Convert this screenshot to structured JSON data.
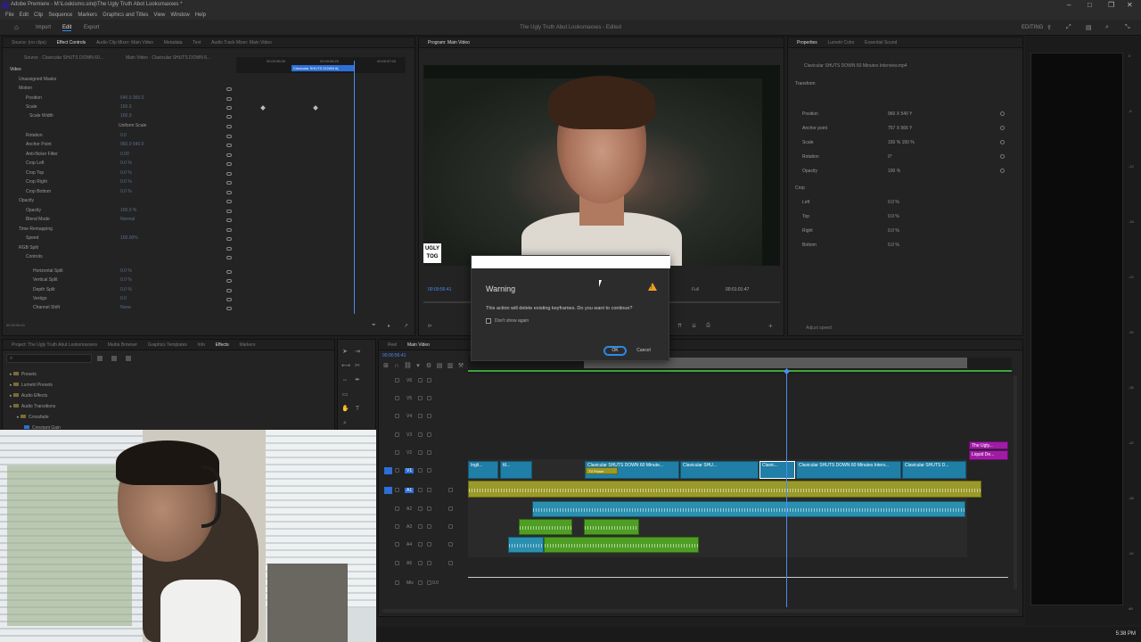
{
  "titlebar": {
    "title": "Adobe Premiere - M:\\Lookismo.sinq\\The Ugly Truth Abot Looksmaxxes *"
  },
  "menus": [
    "File",
    "Edit",
    "Clip",
    "Sequence",
    "Markers",
    "Graphics and Titles",
    "View",
    "Window",
    "Help"
  ],
  "workspaces": {
    "home_icon": "home-icon",
    "items": [
      "Import",
      "Edit",
      "Export"
    ],
    "active": "Edit",
    "doc_title": "The Ugly Truth Abut Looksmaxxes - Edited",
    "right_label": "EDITING"
  },
  "effect_controls": {
    "tabs": [
      "Source: (no clips)",
      "Effect Controls",
      "Audio Clip Mixer: Main Video",
      "Metadata",
      "Text",
      "Audio Track Mixer: Main Video"
    ],
    "active_tab": "Effect Controls",
    "master": "Source · Clavicular SHUTS DOWN 60...",
    "sequence": "Main Video · Clavicular SHUTS DOWN 6...",
    "timeline_start": "00:00:56:00",
    "timeline_mid": "00:00:56:20",
    "timeline_end": "00:00:57:00",
    "clip_label": "Clavicular SHUTS DOWN 6(",
    "section_video": "Video",
    "section_masks": "Unassigned Masks",
    "rows": [
      {
        "label": "Motion",
        "value": ""
      },
      {
        "label": "Position",
        "value": "640.0  360.0"
      },
      {
        "label": "Scale",
        "value": "150.0"
      },
      {
        "label": "Scale Width",
        "value": "100.0"
      },
      {
        "label": "Uniform Scale",
        "value": ""
      },
      {
        "label": "Rotation",
        "value": "0.0"
      },
      {
        "label": "Anchor Point",
        "value": "960.0  540.0"
      },
      {
        "label": "Anti-flicker Filter",
        "value": "0.00"
      },
      {
        "label": "Crop Left",
        "value": "0.0 %"
      },
      {
        "label": "Crop Top",
        "value": "0.0 %"
      },
      {
        "label": "Crop Right",
        "value": "0.0 %"
      },
      {
        "label": "Crop Bottom",
        "value": "0.0 %"
      },
      {
        "label": "Opacity",
        "value": ""
      },
      {
        "label": "Opacity",
        "value": "100.0 %"
      },
      {
        "label": "Blend Mode",
        "value": "Normal"
      },
      {
        "label": "Time Remapping",
        "value": ""
      },
      {
        "label": "Speed",
        "value": "100.00%"
      },
      {
        "label": "RGB Split",
        "value": ""
      },
      {
        "label": "Controls",
        "value": ""
      },
      {
        "label": "Horizontal Split",
        "value": "0.0 %"
      },
      {
        "label": "Vertical Split",
        "value": "0.0 %"
      },
      {
        "label": "Depth Split",
        "value": "0.0 %"
      },
      {
        "label": "Vertigo",
        "value": "0.0"
      },
      {
        "label": "Channel Shift",
        "value": "None"
      }
    ],
    "composite_label": "Composite Mode",
    "timecode": "00:00:56:41"
  },
  "program_monitor": {
    "tab": "Program: Main Video",
    "timecode_left": "00:00:56:41",
    "fit": "Full",
    "timecode_right": "00:01:01:47",
    "logo_text": "UGLY TOG"
  },
  "properties": {
    "tabs": [
      "Properties",
      "Lumetri Color",
      "Essential Sound"
    ],
    "clip_name": "Clavicular SHUTS DOWN 60 Minutes Interview.mp4",
    "transform_label": "Transform",
    "crop_label": "Crop",
    "rows": [
      {
        "label": "Position",
        "value": "960 X   540 Y"
      },
      {
        "label": "Anchor point",
        "value": "757 X   566 Y"
      },
      {
        "label": "Scale",
        "value": "150 %   150 %"
      },
      {
        "label": "Rotation",
        "value": "0°"
      },
      {
        "label": "Opacity",
        "value": "100 %"
      }
    ],
    "crop_rows": [
      {
        "label": "Left",
        "value": "0.0 %"
      },
      {
        "label": "Top",
        "value": "0.0 %"
      },
      {
        "label": "Right",
        "value": "0.0 %"
      },
      {
        "label": "Bottom",
        "value": "0.0 %"
      }
    ],
    "adjust_speed": "Adjust speed"
  },
  "project_panel": {
    "tabs": [
      "Project: The Ugly Truth Abut Looksmaxxers",
      "Media Browser",
      "Graphics Templates",
      "Info",
      "Effects",
      "Markers"
    ],
    "active_tab": "Effects",
    "tree": [
      "Presets",
      "Lumetri Presets",
      "Audio Effects",
      "Audio Transitions",
      "Crossfade",
      "Constant Gain"
    ]
  },
  "timeline": {
    "tabs": [
      "Reel",
      "Main Video"
    ],
    "active_tab": "Main Video",
    "timecode": "00:00:56:41",
    "tracks": [
      {
        "name": "V6",
        "type": "video"
      },
      {
        "name": "V5",
        "type": "video"
      },
      {
        "name": "V4",
        "type": "video"
      },
      {
        "name": "V3",
        "type": "video"
      },
      {
        "name": "V2",
        "type": "video"
      },
      {
        "name": "V1",
        "type": "video"
      },
      {
        "name": "A1",
        "type": "audio"
      },
      {
        "name": "A2",
        "type": "audio"
      },
      {
        "name": "A3",
        "type": "audio"
      },
      {
        "name": "A4",
        "type": "audio"
      },
      {
        "name": "A5",
        "type": "audio"
      },
      {
        "name": "Mix",
        "type": "mix",
        "value": "0.0"
      }
    ],
    "clips": {
      "v2_purple_1": "The Ugly...",
      "v2_purple_2": "Liquid De...",
      "v1": [
        "Ingli...",
        "ttl...",
        "Clavicular SHUTS DOWN 60 Minute...",
        "Clavicular SHU...",
        "Clavic...",
        "Clavicular SHUTS DOWN 60 Minutes Interv...",
        "Clavicular SHUTS D..."
      ],
      "v1_sub": "TV Power"
    }
  },
  "dialog": {
    "title": "Warning",
    "message": "This action will delete existing keyframes. Do you want to continue?",
    "checkbox": "Don't show again",
    "ok": "OK",
    "cancel": "Cancel"
  },
  "taskbar": {
    "time": "5:38 PM"
  },
  "meter_ticks": [
    "0",
    "-6",
    "-12",
    "-18",
    "-24",
    "-30",
    "-36",
    "-42",
    "-48",
    "-54",
    "dB"
  ]
}
